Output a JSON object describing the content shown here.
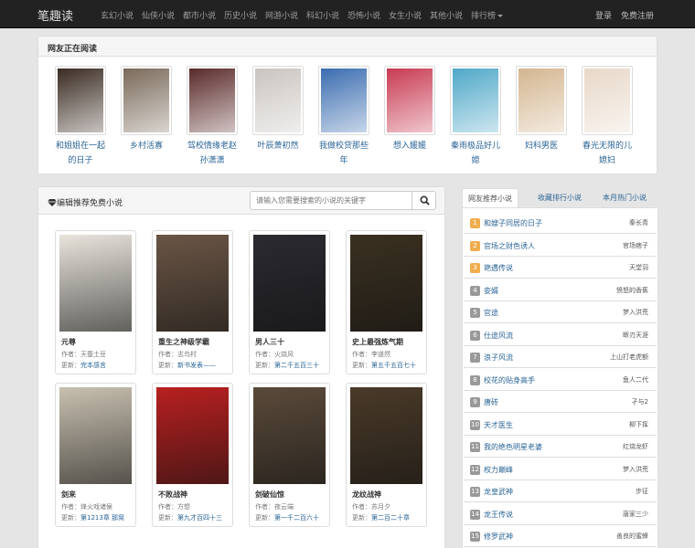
{
  "navbar": {
    "brand": "笔趣读",
    "items": [
      "玄幻小说",
      "仙侠小说",
      "都市小说",
      "历史小说",
      "网游小说",
      "科幻小说",
      "恐怖小说",
      "女生小说",
      "其他小说",
      "排行榜"
    ],
    "login": "登录",
    "register": "免费注册"
  },
  "reading": {
    "title": "网友正在阅读",
    "items": [
      {
        "title": "和姐姐在一起的日子",
        "color": "#3a2b22"
      },
      {
        "title": "乡村活寡",
        "color": "#7a6a5a"
      },
      {
        "title": "驾校情缘老赵孙潇潇",
        "color": "#5a2a2a"
      },
      {
        "title": "叶辰萧初然",
        "color": "#c9c4c0"
      },
      {
        "title": "我做校贷那些年",
        "color": "#3b6db0"
      },
      {
        "title": "想入媛媛",
        "color": "#c83a52"
      },
      {
        "title": "秦雨极品好儿媳",
        "color": "#4fa8c8"
      },
      {
        "title": "妇科男医",
        "color": "#d4b690"
      },
      {
        "title": "春光无限的儿媳妇",
        "color": "#e8d8c8"
      }
    ]
  },
  "recommend": {
    "title": "编辑推荐免费小说",
    "search_placeholder": "请输入您需要搜索的小说的关键字",
    "author_prefix": "作者：",
    "update_prefix": "更新：",
    "books": [
      {
        "name": "元尊",
        "author": "天蚕土豆",
        "update": "完本感言",
        "color": "#e8e4dc"
      },
      {
        "name": "重生之神级学霸",
        "author": "志鸟村",
        "update": "新书发表——",
        "color": "#6a5545"
      },
      {
        "name": "男人三十",
        "author": "火烧风",
        "update": "第二千五百三十",
        "color": "#2a2a30"
      },
      {
        "name": "史上最强炼气期",
        "author": "李道然",
        "update": "第五千五百七十",
        "color": "#3a3020"
      },
      {
        "name": "剑来",
        "author": "烽火戏诸侯",
        "update": "第1213章 那窝",
        "color": "#c8c0b0"
      },
      {
        "name": "不败战神",
        "author": "方想",
        "update": "第九才百四十三",
        "color": "#b82020"
      },
      {
        "name": "剑破仙惊",
        "author": "夜云端",
        "update": "第一千二百六十",
        "color": "#5a4a3a"
      },
      {
        "name": "龙纹战神",
        "author": "苏月夕",
        "update": "第二百二十章",
        "color": "#4a3a28"
      }
    ]
  },
  "ranking": {
    "tabs": [
      "网友推荐小说",
      "收藏排行小说",
      "本月热门小说"
    ],
    "rows": [
      {
        "num": "1",
        "title": "和嫂子同居的日子",
        "author": "秦长青"
      },
      {
        "num": "2",
        "title": "官场之财色诱人",
        "author": "官场痞子"
      },
      {
        "num": "3",
        "title": "艳遇传说",
        "author": "天堂羽"
      },
      {
        "num": "4",
        "title": "娈婿",
        "author": "愤怒的香蕉"
      },
      {
        "num": "5",
        "title": "官途",
        "author": "梦入洪荒"
      },
      {
        "num": "6",
        "title": "仕途风流",
        "author": "断刃天涯"
      },
      {
        "num": "7",
        "title": "浪子风流",
        "author": "上山打老虎额"
      },
      {
        "num": "8",
        "title": "校花的贴身高手",
        "author": "鱼人二代"
      },
      {
        "num": "9",
        "title": "唐砖",
        "author": "孑与2"
      },
      {
        "num": "10",
        "title": "天才医生",
        "author": "柳下挥"
      },
      {
        "num": "11",
        "title": "我的绝色明星老婆",
        "author": "红烧龙虾"
      },
      {
        "num": "12",
        "title": "权力巅峰",
        "author": "梦入洪荒"
      },
      {
        "num": "13",
        "title": "龙皇武神",
        "author": "步征"
      },
      {
        "num": "14",
        "title": "龙王传说",
        "author": "唐家三少"
      },
      {
        "num": "15",
        "title": "修罗武神",
        "author": "善良的蜜蜂"
      }
    ]
  }
}
